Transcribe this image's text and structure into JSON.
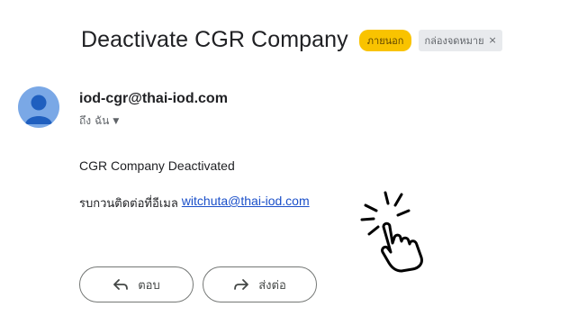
{
  "email": {
    "subject": "Deactivate CGR Company",
    "labels": {
      "external": "ภายนอก",
      "inbox": "กล่องจดหมาย",
      "inbox_remove": "×"
    },
    "sender": "iod-cgr@thai-iod.com",
    "recipient_line": "ถึง ฉัน",
    "body": {
      "line1": "CGR Company Deactivated",
      "line2_prefix": "รบกวนติดต่อที่อีเมล",
      "contact_email": "witchuta@thai-iod.com"
    }
  },
  "actions": {
    "reply": "ตอบ",
    "forward": "ส่งต่อ"
  },
  "colors": {
    "external_badge": "#f9c300",
    "link": "#1a4fc9",
    "avatar": "#7aa8e6"
  },
  "icons": [
    "person-avatar-icon",
    "chevron-down-icon",
    "reply-arrow-icon",
    "forward-arrow-icon",
    "hand-pointer-icon"
  ]
}
